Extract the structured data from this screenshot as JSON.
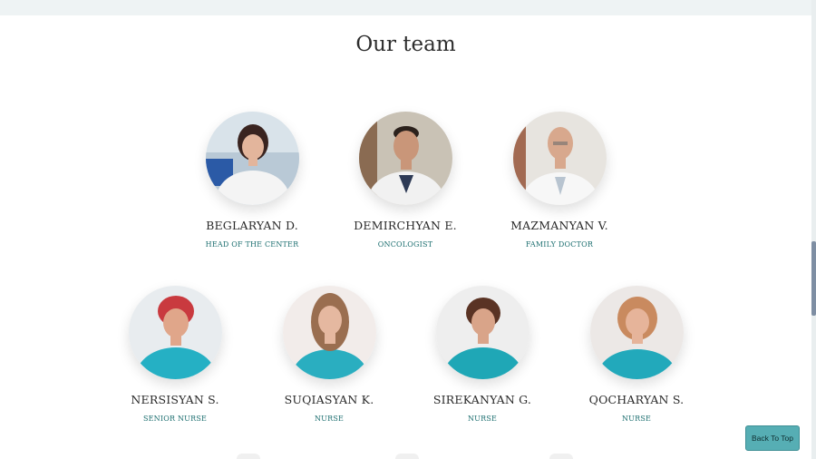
{
  "page": {
    "title": "Our team"
  },
  "team": [
    {
      "name": "BEGLARYAN D.",
      "role": "HEAD OF THE CENTER"
    },
    {
      "name": "DEMIRCHYAN E.",
      "role": "ONCOLOGIST"
    },
    {
      "name": "MAZMANYAN V.",
      "role": "FAMILY DOCTOR"
    },
    {
      "name": "NERSISYAN S.",
      "role": "SENIOR NURSE"
    },
    {
      "name": "SUQIASYAN K.",
      "role": "NURSE"
    },
    {
      "name": "SIREKANYAN G.",
      "role": "NURSE"
    },
    {
      "name": "QOCHARYAN S.",
      "role": "NURSE"
    }
  ],
  "back_to_top": {
    "label": "Back To Top"
  },
  "colors": {
    "accent": "#1d6f70",
    "button": "#56aeb4",
    "scrub": "#25b0c4"
  }
}
